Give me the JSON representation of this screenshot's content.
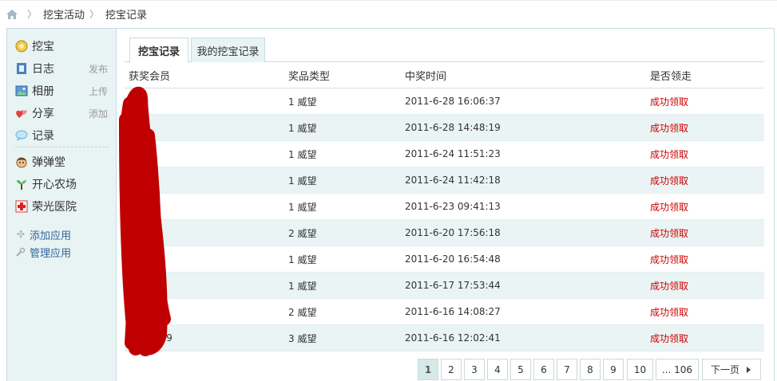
{
  "breadcrumb": {
    "home_icon": "home-icon",
    "items": [
      "挖宝活动",
      "挖宝记录"
    ]
  },
  "sidebar": {
    "items": [
      {
        "label": "挖宝",
        "icon": "treasure-icon",
        "extra": ""
      },
      {
        "label": "日志",
        "icon": "blog-icon",
        "extra": "发布"
      },
      {
        "label": "相册",
        "icon": "album-icon",
        "extra": "上传"
      },
      {
        "label": "分享",
        "icon": "share-icon",
        "extra": "添加"
      },
      {
        "label": "记录",
        "icon": "record-icon",
        "extra": ""
      },
      {
        "label": "弹弹堂",
        "icon": "game-icon",
        "extra": ""
      },
      {
        "label": "开心农场",
        "icon": "farm-icon",
        "extra": ""
      },
      {
        "label": "荣光医院",
        "icon": "hospital-icon",
        "extra": ""
      }
    ],
    "links": [
      {
        "label": "添加应用",
        "icon": "add-icon"
      },
      {
        "label": "管理应用",
        "icon": "wrench-icon"
      }
    ]
  },
  "tabs": [
    {
      "label": "挖宝记录",
      "active": true
    },
    {
      "label": "我的挖宝记录",
      "active": false
    }
  ],
  "table": {
    "headers": [
      "获奖会员",
      "奖品类型",
      "中奖时间",
      "是否领走"
    ],
    "rows": [
      {
        "member": "",
        "prize": "1 威望",
        "time": "2011-6-28 16:06:37",
        "status": "成功领取"
      },
      {
        "member": "",
        "prize": "1 威望",
        "time": "2011-6-28 14:48:19",
        "status": "成功领取"
      },
      {
        "member": "",
        "prize": "1 威望",
        "time": "2011-6-24 11:51:23",
        "status": "成功领取"
      },
      {
        "member": "",
        "prize": "1 威望",
        "time": "2011-6-24 11:42:18",
        "status": "成功领取"
      },
      {
        "member": "",
        "prize": "1 威望",
        "time": "2011-6-23 09:41:13",
        "status": "成功领取"
      },
      {
        "member": "",
        "prize": "2 威望",
        "time": "2011-6-20 17:56:18",
        "status": "成功领取"
      },
      {
        "member": "",
        "prize": "1 威望",
        "time": "2011-6-20 16:54:48",
        "status": "成功领取"
      },
      {
        "member": "",
        "prize": "1 威望",
        "time": "2011-6-17 17:53:44",
        "status": "成功领取"
      },
      {
        "member": "",
        "prize": "2 威望",
        "time": "2011-6-16 14:08:27",
        "status": "成功领取"
      },
      {
        "member": "639",
        "prize": "3 威望",
        "time": "2011-6-16 12:02:41",
        "status": "成功领取"
      }
    ]
  },
  "pagination": {
    "pages": [
      "1",
      "2",
      "3",
      "4",
      "5",
      "6",
      "7",
      "8",
      "9",
      "10",
      "... 106"
    ],
    "current": "1",
    "next_label": "下一页"
  },
  "colors": {
    "sidebar_bg": "#e8f3f3",
    "row_alt": "#eaf4f4",
    "status_red": "#cc0000",
    "redaction": "#c00000"
  }
}
